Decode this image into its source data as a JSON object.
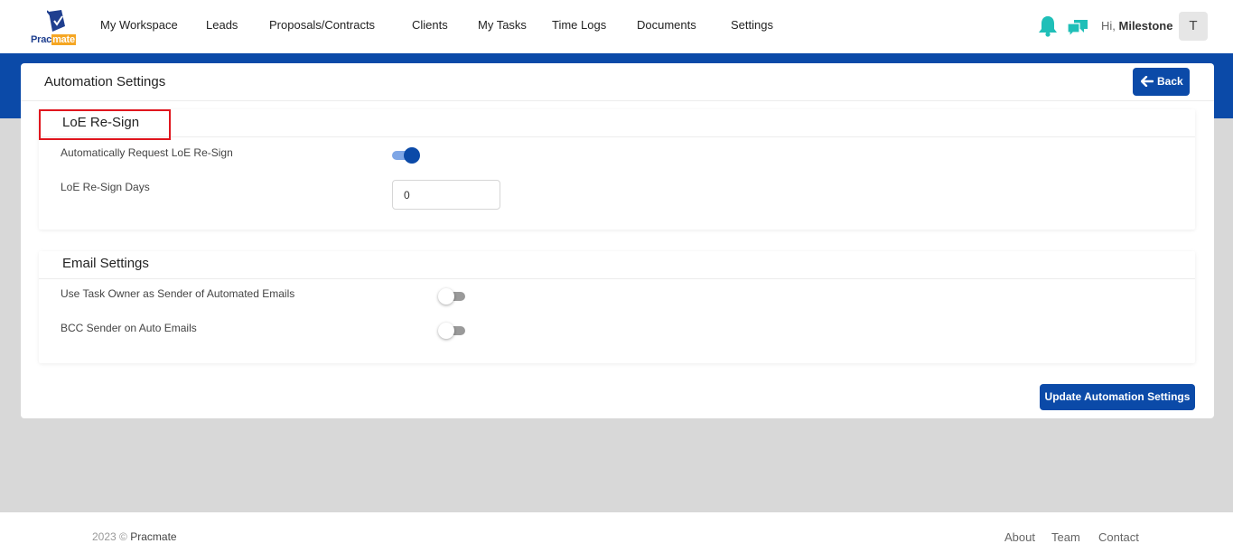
{
  "brand": {
    "logo_prefix": "Prac",
    "logo_suffix": "mate"
  },
  "nav": {
    "items": [
      {
        "label": "My Workspace"
      },
      {
        "label": "Leads"
      },
      {
        "label": "Proposals/Contracts"
      },
      {
        "label": "Clients"
      },
      {
        "label": "My Tasks"
      },
      {
        "label": "Time Logs"
      },
      {
        "label": "Documents"
      },
      {
        "label": "Settings"
      }
    ],
    "greeting_prefix": "Hi, ",
    "user_name": "Milestone",
    "avatar_initial": "T",
    "icons": {
      "notifications": "bell-icon",
      "messages": "chat-icon"
    },
    "icon_color": "#1fbfb8"
  },
  "page": {
    "title": "Automation Settings",
    "back_label": "Back",
    "accent_color": "#0b4aa8"
  },
  "loe_section": {
    "title": "LoE Re-Sign",
    "auto_request_label": "Automatically Request LoE Re-Sign",
    "auto_request_enabled": true,
    "days_label": "LoE Re-Sign Days",
    "days_value": "0"
  },
  "email_section": {
    "title": "Email Settings",
    "task_owner_sender_label": "Use Task Owner as Sender of Automated Emails",
    "task_owner_sender_enabled": false,
    "bcc_sender_label": "BCC Sender on Auto Emails",
    "bcc_sender_enabled": false
  },
  "actions": {
    "update_label": "Update Automation Settings"
  },
  "footer": {
    "copyright": "2023 © ",
    "company": "Pracmate",
    "links": [
      {
        "label": "About"
      },
      {
        "label": "Team"
      },
      {
        "label": "Contact"
      }
    ]
  }
}
